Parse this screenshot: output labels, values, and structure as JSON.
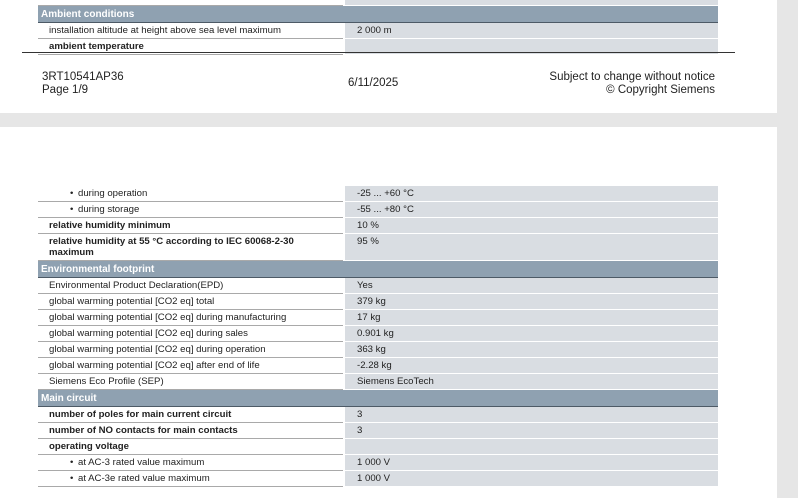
{
  "page1": {
    "section": "Ambient conditions",
    "rows": [
      {
        "label": "installation altitude at height above sea level maximum",
        "value": "2 000 m"
      },
      {
        "label": "ambient temperature",
        "value": ""
      }
    ],
    "footer": {
      "product_code": "3RT10541AP36",
      "page_label": "Page 1/9",
      "date": "6/11/2025",
      "notice": "Subject to change without notice",
      "copyright": "© Copyright Siemens"
    }
  },
  "page2": {
    "rows_top": [
      {
        "label": "during operation",
        "value": "-25 ... +60 °C"
      },
      {
        "label": "during storage",
        "value": "-55 ... +80 °C"
      },
      {
        "label": "relative humidity minimum",
        "value": "10 %"
      },
      {
        "label": "relative humidity at 55 °C according to IEC 60068-2-30 maximum",
        "value": "95 %"
      }
    ],
    "section_env": "Environmental footprint",
    "rows_env": [
      {
        "label": "Environmental Product Declaration(EPD)",
        "value": "Yes"
      },
      {
        "label": "global warming potential [CO2 eq] total",
        "value": "379 kg"
      },
      {
        "label": "global warming potential [CO2 eq] during manufacturing",
        "value": "17 kg"
      },
      {
        "label": "global warming potential [CO2 eq] during sales",
        "value": "0.901 kg"
      },
      {
        "label": "global warming potential [CO2 eq] during operation",
        "value": "363 kg"
      },
      {
        "label": "global warming potential [CO2 eq] after end of life",
        "value": "-2.28 kg"
      },
      {
        "label": "Siemens Eco Profile (SEP)",
        "value": "Siemens EcoTech"
      }
    ],
    "section_main": "Main circuit",
    "rows_main": [
      {
        "label": "number of poles for main current circuit",
        "value": "3"
      },
      {
        "label": "number of NO contacts for main contacts",
        "value": "3"
      },
      {
        "label": "operating voltage",
        "value": ""
      },
      {
        "label": "at AC-3 rated value maximum",
        "value": "1 000 V"
      },
      {
        "label": "at AC-3e rated value maximum",
        "value": "1 000 V"
      }
    ]
  },
  "bullet": "•"
}
